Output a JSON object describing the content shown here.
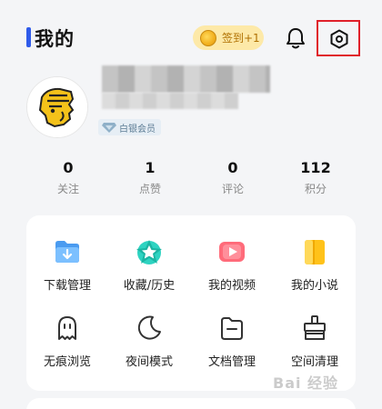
{
  "header": {
    "title": "我的",
    "signin_label": "签到+1"
  },
  "profile": {
    "member_badge": "白银会员"
  },
  "stats": [
    {
      "value": "0",
      "label": "关注"
    },
    {
      "value": "1",
      "label": "点赞"
    },
    {
      "value": "0",
      "label": "评论"
    },
    {
      "value": "112",
      "label": "积分"
    }
  ],
  "tools": [
    {
      "label": "下载管理",
      "icon": "download-folder-icon"
    },
    {
      "label": "收藏/历史",
      "icon": "star-icon"
    },
    {
      "label": "我的视频",
      "icon": "video-icon"
    },
    {
      "label": "我的小说",
      "icon": "book-icon"
    },
    {
      "label": "无痕浏览",
      "icon": "ghost-icon"
    },
    {
      "label": "夜间模式",
      "icon": "moon-icon"
    },
    {
      "label": "文档管理",
      "icon": "document-folder-icon"
    },
    {
      "label": "空间清理",
      "icon": "cleanup-icon"
    }
  ],
  "watermark": "Bai 经验",
  "colors": {
    "accent": "#2f5bea",
    "highlight_border": "#e0202a",
    "signin_bg": "#fde9a8"
  }
}
